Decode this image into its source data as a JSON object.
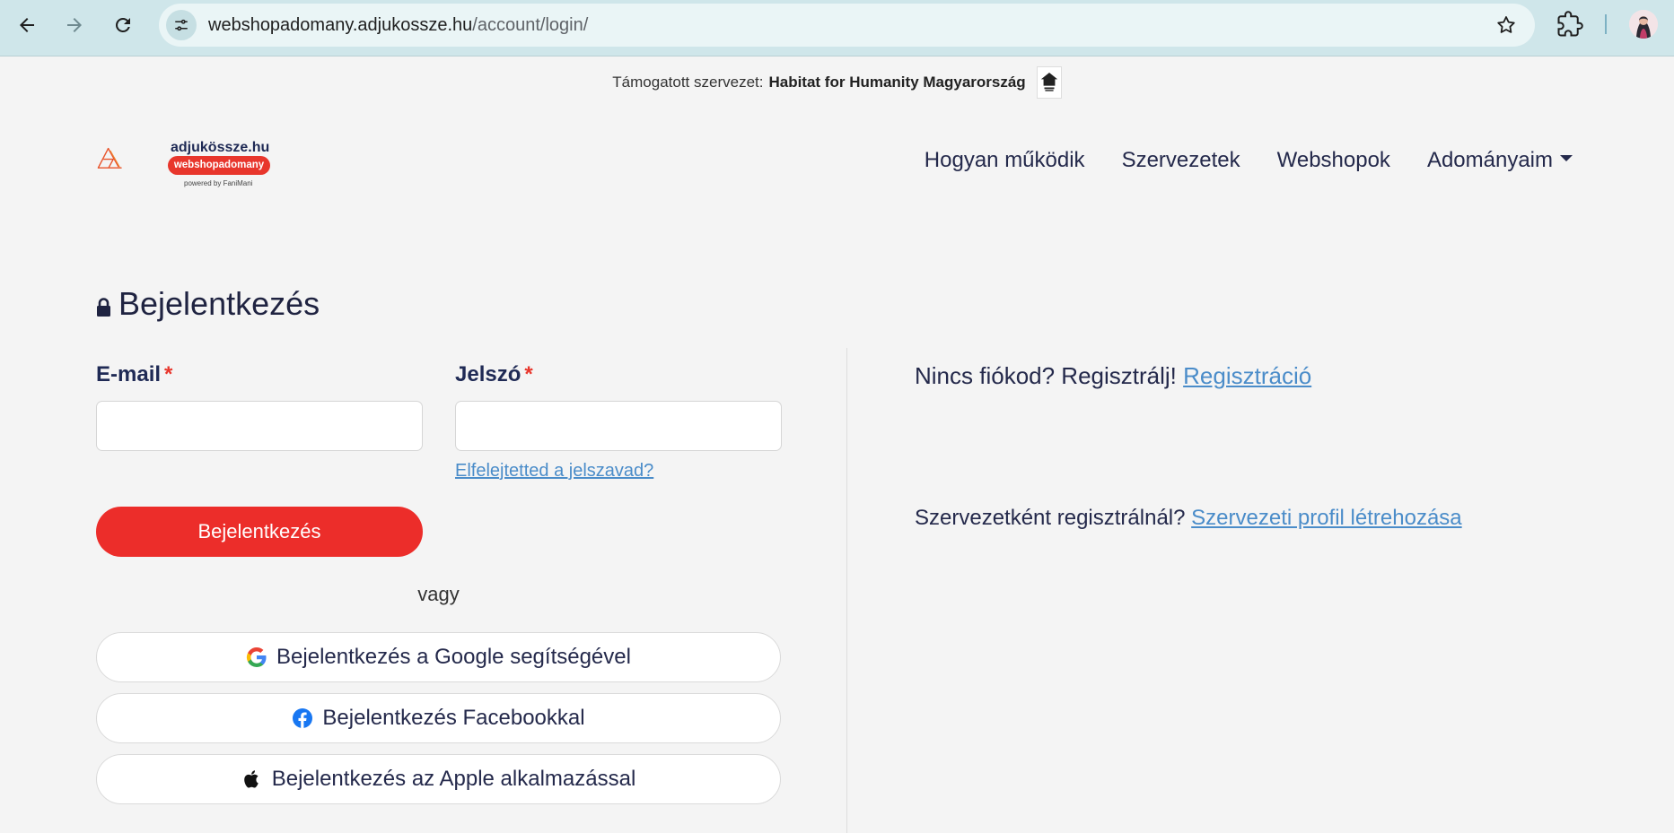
{
  "browser": {
    "url_host": "webshopadomany.adjukossze.hu",
    "url_path": "/account/login/"
  },
  "support_bar": {
    "prefix": "Támogatott szervezet:",
    "org_name": "Habitat for Humanity Magyarország"
  },
  "brand": {
    "name": "adjukössze.hu",
    "pill": "webshopadomany",
    "powered": "powered by FaniMani",
    "accent": "#e8362c"
  },
  "nav": {
    "items": [
      "Hogyan működik",
      "Szervezetek",
      "Webshopok",
      "Adományaim"
    ]
  },
  "page": {
    "title": "Bejelentkezés"
  },
  "form": {
    "email_label": "E-mail",
    "password_label": "Jelszó",
    "required_mark": "*",
    "forgot_link": "Elfelejtetted a jelszavad?",
    "submit_label": "Bejelentkezés",
    "or_text": "vagy",
    "google_label": "Bejelentkezés a Google segítségével",
    "facebook_label": "Bejelentkezés Facebookkal",
    "apple_label": "Bejelentkezés az Apple alkalmazással"
  },
  "side": {
    "no_account_text": "Nincs fiókod? Regisztrálj!",
    "register_link": "Regisztráció",
    "org_text": "Szervezetként regisztrálnál?",
    "org_link": "Szervezeti profil létrehozása"
  },
  "colors": {
    "primary_button": "#ec2d2a",
    "link": "#4a8cc9",
    "chrome_bg": "#cfe6ea"
  }
}
